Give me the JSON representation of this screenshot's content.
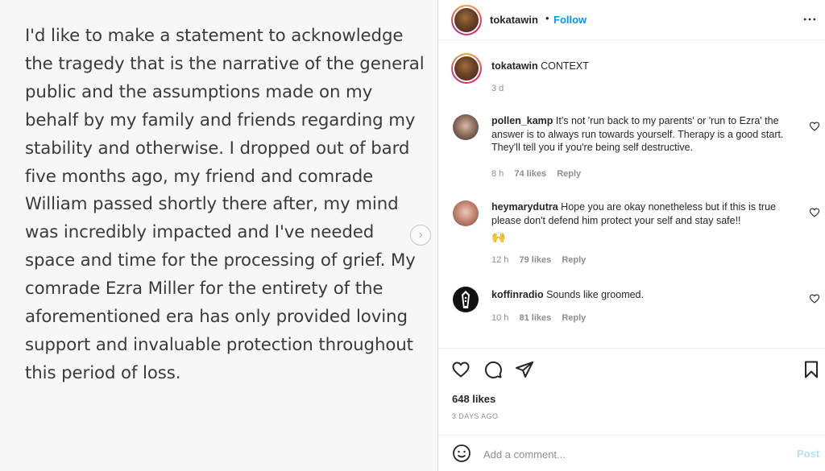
{
  "media": {
    "statement": "I'd like to make a statement to acknowledge the tragedy that is the narrative of the general public and the assumptions made on my behalf by my family and friends regarding my stability and otherwise. I dropped out of bard five months ago, my friend and comrade William passed shortly there after, my mind was incredibly impacted and I've needed space and time for the processing of grief. My comrade Ezra Miller for the entirety of the aforementioned era has only provided loving support and invaluable protection throughout this period of loss.",
    "next_icon": "chevron-right-icon"
  },
  "header": {
    "username": "tokatawin",
    "separator": "•",
    "follow_label": "Follow",
    "more_icon": "more-horizontal-icon"
  },
  "caption": {
    "username": "tokatawin",
    "text": "CONTEXT",
    "time": "3 d"
  },
  "comments": [
    {
      "username": "pollen_kamp",
      "text": "It's not 'run back to my parents' or 'run to Ezra' the answer is to always run towards yourself. Therapy is a good start. They'll tell you if you're being self destructive.",
      "time": "8 h",
      "likes": "74 likes",
      "reply": "Reply"
    },
    {
      "username": "heymarydutra",
      "text": "Hope you are okay nonetheless but if this is true please don't defend him protect your self and stay safe!!",
      "emoji": "🙌",
      "time": "12 h",
      "likes": "79 likes",
      "reply": "Reply"
    },
    {
      "username": "koffinradio",
      "text": "Sounds like groomed.",
      "time": "10 h",
      "likes": "81 likes",
      "reply": "Reply"
    }
  ],
  "actions": {
    "icons": [
      "heart-icon",
      "comment-icon",
      "share-icon",
      "bookmark-icon"
    ],
    "likes": "648 likes",
    "posted": "3 DAYS AGO"
  },
  "add_comment": {
    "placeholder": "Add a comment...",
    "post_label": "Post",
    "emoji_icon": "smiley-icon"
  },
  "colors": {
    "accent": "#0095f6",
    "post_disabled": "#b2dffc",
    "secondary_text": "#8e8e8e"
  }
}
